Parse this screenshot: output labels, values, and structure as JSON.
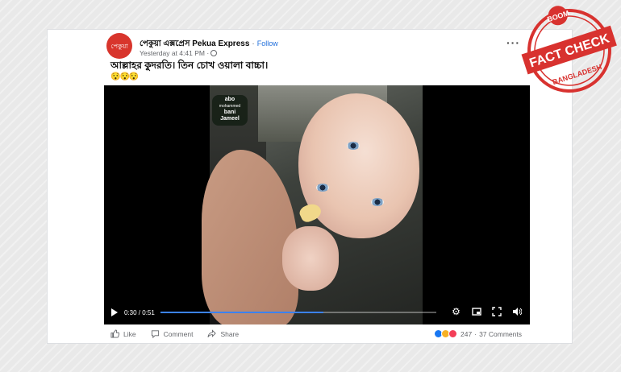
{
  "post": {
    "avatar_text": "পেকুয়া",
    "page_name": "পেকুয়া এক্সপ্রেস Pekua Express",
    "separator": "·",
    "follow_label": "Follow",
    "timestamp": "Yesterday at 4:41 PM ·",
    "caption": "আল্লাহর কুদরতি। তিন চোখ ওয়ালা বাচ্চা।",
    "emojis": "😯😯😯",
    "more_label": "···"
  },
  "video": {
    "watermark_line1": "abo",
    "watermark_line2": "mohammed",
    "watermark_line3": "bani",
    "watermark_line4": "Jameel",
    "time": "0:30 / 0:51",
    "progress": 0.59,
    "icons": [
      "play-icon",
      "settings-icon",
      "pip-icon",
      "fullscreen-icon",
      "volume-icon"
    ]
  },
  "actions": {
    "like_label": "Like",
    "comment_label": "Comment",
    "share_label": "Share"
  },
  "reactions": {
    "count": "247",
    "separator": "·",
    "comments": "37 Comments"
  },
  "badge": {
    "top_text": "BOOM",
    "main_text": "FACT CHECK",
    "bottom_text": "BANGLADESH",
    "color": "#d8322f"
  }
}
